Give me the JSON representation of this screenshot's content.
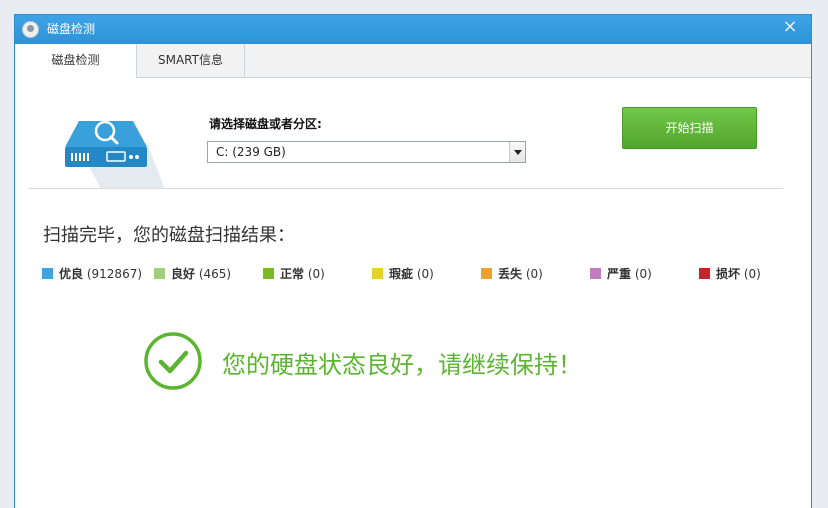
{
  "window": {
    "title": "磁盘检测",
    "close_glyph": "×",
    "app_icon": "hard-disk-app-icon"
  },
  "tabs": [
    {
      "label": "磁盘检测",
      "active": true
    },
    {
      "label": "SMART信息",
      "active": false
    }
  ],
  "disk_selector": {
    "label": "请选择磁盘或者分区:",
    "selected": "C:  (239 GB)",
    "icon": "hard-disk-search-icon"
  },
  "start_button": {
    "label": "开始扫描"
  },
  "result": {
    "title": "扫描完毕，您的磁盘扫描结果：",
    "legend": [
      {
        "name": "优良",
        "count": "(912867)",
        "color": "#3ba6de"
      },
      {
        "name": "良好",
        "count": "(465)",
        "color": "#9fd07f"
      },
      {
        "name": "正常",
        "count": "(0)",
        "color": "#7ab92b"
      },
      {
        "name": "瑕疵",
        "count": "(0)",
        "color": "#e6d32a"
      },
      {
        "name": "丢失",
        "count": "(0)",
        "color": "#f0a12a"
      },
      {
        "name": "严重",
        "count": "(0)",
        "color": "#c37cc0"
      },
      {
        "name": "损坏",
        "count": "(0)",
        "color": "#c0262a"
      }
    ],
    "status_message": "您的硬盘状态良好，请继续保持！",
    "status_icon": "check-circle-icon"
  },
  "colors": {
    "title_bar": "#2c93d8",
    "start_button": "#5eb536",
    "status_green": "#5cb531"
  }
}
